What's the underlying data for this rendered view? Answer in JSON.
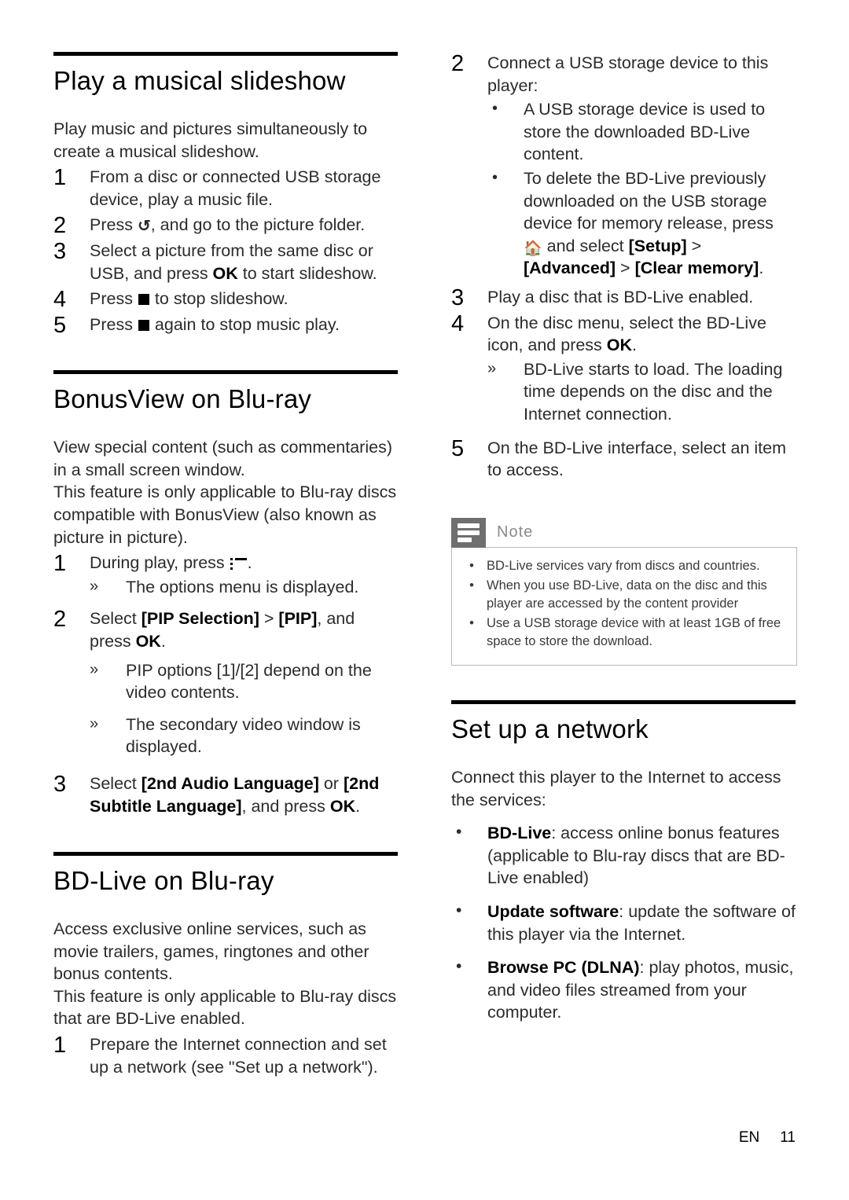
{
  "page": {
    "footer_language": "EN",
    "footer_page_number": "11"
  },
  "icons": {
    "back_arrow": "↺",
    "stop_square": "stop-icon",
    "options_menu": "options-menu-icon",
    "home": "⌂",
    "note_badge": "note-lines-icon",
    "bullet": "•",
    "sub_arrow": "»"
  },
  "left_column": {
    "sections": [
      {
        "title": "Play a musical slideshow",
        "intro": "Play music and pictures simultaneously to create a musical slideshow.",
        "steps": [
          {
            "num": "1",
            "text": "From a disc or connected USB storage device, play a music file."
          },
          {
            "num": "2",
            "text_before": "Press ",
            "text_after": ", and go to the picture folder.",
            "icon": "back_arrow"
          },
          {
            "num": "3",
            "text_before": "Select a picture from the same disc or USB, and press ",
            "bold": "OK",
            "text_after": " to start slideshow."
          },
          {
            "num": "4",
            "text_before": "Press ",
            "text_after": " to stop slideshow.",
            "icon": "stop_square"
          },
          {
            "num": "5",
            "text_before": "Press ",
            "text_after": " again to stop music play.",
            "icon": "stop_square"
          }
        ]
      },
      {
        "title": "BonusView on Blu-ray",
        "intro_1": "View special content (such as commentaries) in a small screen window.",
        "intro_2": "This feature is only applicable to Blu-ray discs compatible with BonusView (also known as picture in picture).",
        "steps": [
          {
            "num": "1",
            "text_before": "During play, press ",
            "text_after": ".",
            "icon": "options_menu",
            "subs": [
              "The options menu is displayed."
            ]
          },
          {
            "num": "2",
            "text_before": "Select ",
            "bold_1": "[PIP Selection]",
            "mid": " > ",
            "bold_2": "[PIP]",
            "text_mid": ", and press ",
            "bold_3": "OK",
            "text_after": ".",
            "subs": [
              "PIP options [1]/[2] depend on the video contents.",
              "The secondary video window is displayed."
            ]
          },
          {
            "num": "3",
            "text_before": "Select ",
            "bold_1": "[2nd Audio Language]",
            "mid": " or ",
            "bold_2": "[2nd Subtitle Language]",
            "text_mid": ", and press ",
            "bold_3": "OK",
            "text_after": "."
          }
        ]
      },
      {
        "title": "BD-Live on Blu-ray",
        "intro_1": "Access exclusive online services, such as movie trailers, games, ringtones and other bonus contents.",
        "intro_2": "This feature is only applicable to Blu-ray discs that are BD-Live enabled.",
        "steps": [
          {
            "num": "1",
            "text": "Prepare the Internet connection and set up a network (see \"Set up a network\")."
          }
        ]
      }
    ]
  },
  "right_column": {
    "continued_steps": [
      {
        "num": "2",
        "text": "Connect a USB storage device to this player:",
        "bullets": [
          {
            "text": "A USB storage device is used to store the downloaded BD-Live content."
          },
          {
            "text_before": "To delete the BD-Live previously downloaded on the USB storage device for memory release, press ",
            "icon": "home",
            "text_mid": " and select ",
            "bold_1": "[Setup]",
            "sep_1": " > ",
            "bold_2": "[Advanced]",
            "sep_2": " > ",
            "bold_3": "[Clear memory]",
            "text_after": "."
          }
        ]
      },
      {
        "num": "3",
        "text": "Play a disc that is BD-Live enabled."
      },
      {
        "num": "4",
        "text_before": "On the disc menu, select the BD-Live icon, and press ",
        "bold": "OK",
        "text_after": ".",
        "subs": [
          "BD-Live starts to load. The loading time depends on the disc and the Internet connection."
        ]
      },
      {
        "num": "5",
        "text": "On the BD-Live interface, select an item to access."
      }
    ],
    "note": {
      "title": "Note",
      "items": [
        "BD-Live services vary from discs and countries.",
        "When you use BD-Live, data on the disc and this player are accessed by the content provider",
        "Use a USB storage device with at least 1GB of free space to store the download."
      ]
    },
    "section": {
      "title": "Set up a network",
      "intro": "Connect this player to the Internet to access the services:",
      "bullets": [
        {
          "bold": "BD-Live",
          "text": ": access online bonus features (applicable to Blu-ray discs that are BD-Live enabled)"
        },
        {
          "bold": "Update software",
          "text": ": update the software of this player via the Internet."
        },
        {
          "bold": "Browse PC (DLNA)",
          "text": ": play photos, music, and video files streamed from your computer."
        }
      ]
    }
  }
}
